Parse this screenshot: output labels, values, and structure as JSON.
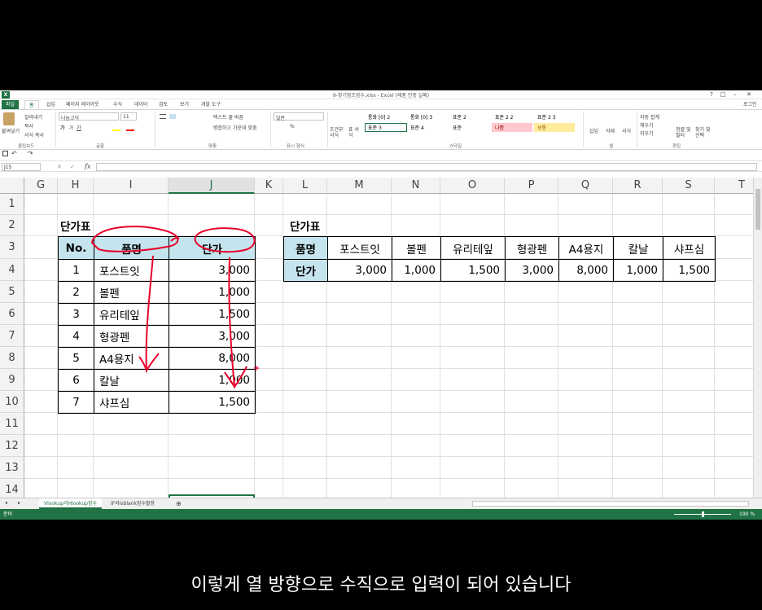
{
  "window": {
    "title": "9-찾기참조함수.xlsx - Excel (제품 인증 실패)",
    "help": "?",
    "restore": "□",
    "minimize": "–",
    "close": "✕",
    "login": "로그인"
  },
  "ribbon_tabs": [
    "파일",
    "홈",
    "삽입",
    "페이지 레이아웃",
    "수식",
    "데이터",
    "검토",
    "보기",
    "개발 도구"
  ],
  "ribbon": {
    "clipboard": {
      "paste": "붙여넣기",
      "cut": "잘라내기",
      "copy": "복사",
      "format_painter": "서식 복사",
      "label": "클립보드"
    },
    "font": {
      "name": "나눔고딕",
      "size": "11",
      "bold": "가",
      "italic": "가",
      "underline": "가",
      "label": "글꼴"
    },
    "alignment": {
      "wrap": "텍스트 줄 바꿈",
      "merge": "병합하고 가운데 맞춤",
      "label": "맞춤"
    },
    "number": {
      "format": "일반",
      "percent": "%",
      "label": "표시 형식"
    },
    "styles": {
      "conditional": "조건부 서식",
      "table": "표 서식",
      "label": "스타일",
      "cells": [
        "통화 [0] 2",
        "통화 [0] 3",
        "표준 2",
        "표준 2 2",
        "표준 2 3",
        "표준 3",
        "표준 4",
        "표준",
        "나쁨",
        "보통"
      ]
    },
    "cells": {
      "insert": "삽입",
      "delete": "삭제",
      "format": "서식",
      "label": "셀"
    },
    "editing": {
      "autosum": "자동 합계",
      "fill": "채우기",
      "clear": "지우기",
      "sort": "정렬 및 필터",
      "find": "찾기 및 선택",
      "label": "편집"
    }
  },
  "formula_bar": {
    "name_box": "J15",
    "fx": "fx",
    "value": ""
  },
  "grid": {
    "columns": [
      "G",
      "H",
      "I",
      "J",
      "K",
      "L",
      "M",
      "N",
      "O",
      "P",
      "Q",
      "R",
      "S",
      "T"
    ],
    "rows": [
      "1",
      "2",
      "3",
      "4",
      "5",
      "6",
      "7",
      "8",
      "9",
      "10",
      "11",
      "12",
      "13",
      "14"
    ],
    "selected_column": "J"
  },
  "vertical_table": {
    "title": "단가표",
    "headers": [
      "No.",
      "품명",
      "단가"
    ],
    "rows": [
      [
        "1",
        "포스트잇",
        "3,000"
      ],
      [
        "2",
        "볼펜",
        "1,000"
      ],
      [
        "3",
        "유리테잎",
        "1,500"
      ],
      [
        "4",
        "형광펜",
        "3,000"
      ],
      [
        "5",
        "A4용지",
        "8,000"
      ],
      [
        "6",
        "칼날",
        "1,000"
      ],
      [
        "7",
        "샤프심",
        "1,500"
      ]
    ]
  },
  "horizontal_table": {
    "title": "단가표",
    "row_headers": [
      "품명",
      "단가"
    ],
    "items": [
      "포스트잇",
      "볼펜",
      "유리테잎",
      "형광펜",
      "A4용지",
      "칼날",
      "샤프심"
    ],
    "prices": [
      "3,000",
      "1,000",
      "1,500",
      "3,000",
      "8,000",
      "1,000",
      "1,500"
    ]
  },
  "sheet_tabs": [
    "Vlookup과Hlookup함수",
    "IF와isblank함수활용"
  ],
  "status": {
    "ready": "준비",
    "zoom": "190 %"
  },
  "subtitle": "이렇게 열 방향으로 수직으로 입력이 되어 있습니다",
  "colors": {
    "excel_green": "#217346",
    "header_fill": "#c5e4ed",
    "annotation_red": "#e8002a",
    "bad_fill": "#ffc7ce",
    "neutral_fill": "#ffeb9c"
  }
}
